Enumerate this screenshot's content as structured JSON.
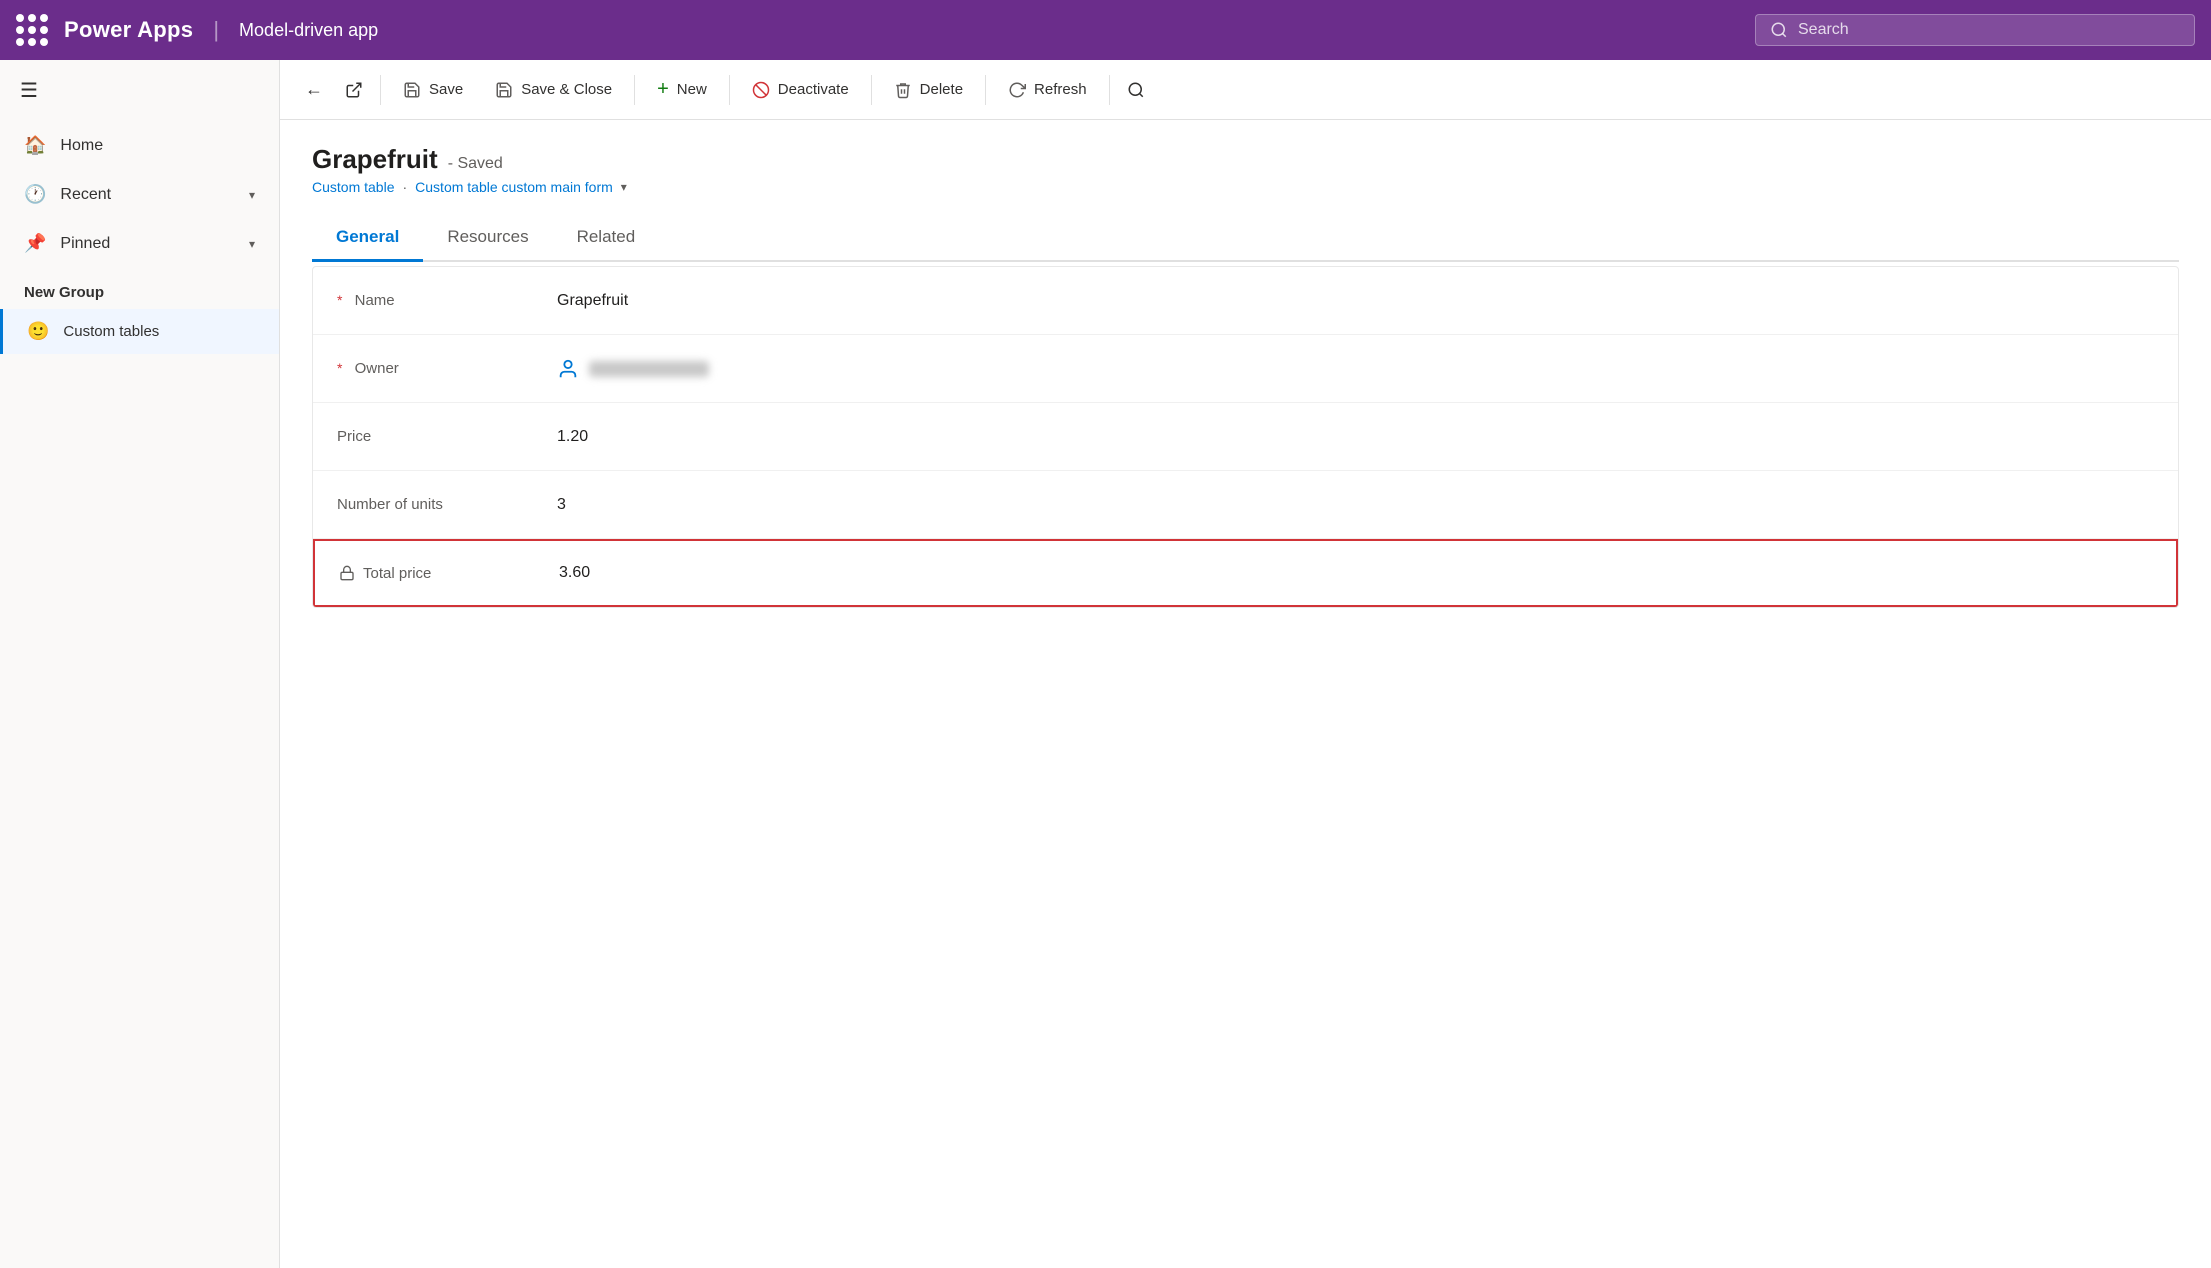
{
  "topbar": {
    "app_name": "Power Apps",
    "divider": "|",
    "model_app": "Model-driven app",
    "search_placeholder": "Search"
  },
  "sidebar": {
    "nav_items": [
      {
        "id": "home",
        "label": "Home",
        "icon": "🏠"
      },
      {
        "id": "recent",
        "label": "Recent",
        "icon": "🕐",
        "has_chevron": true
      },
      {
        "id": "pinned",
        "label": "Pinned",
        "icon": "📌",
        "has_chevron": true
      }
    ],
    "section_header": "New Group",
    "custom_item": {
      "label": "Custom tables",
      "emoji": "🙂"
    }
  },
  "toolbar": {
    "save_label": "Save",
    "save_close_label": "Save & Close",
    "new_label": "New",
    "deactivate_label": "Deactivate",
    "delete_label": "Delete",
    "refresh_label": "Refresh"
  },
  "page": {
    "title": "Grapefruit",
    "saved_badge": "- Saved",
    "breadcrumb_table": "Custom table",
    "breadcrumb_form": "Custom table custom main form",
    "tabs": [
      {
        "id": "general",
        "label": "General",
        "active": true
      },
      {
        "id": "resources",
        "label": "Resources",
        "active": false
      },
      {
        "id": "related",
        "label": "Related",
        "active": false
      }
    ],
    "form": {
      "fields": [
        {
          "id": "name",
          "label": "Name",
          "required": true,
          "value": "Grapefruit",
          "type": "text"
        },
        {
          "id": "owner",
          "label": "Owner",
          "required": true,
          "value": "",
          "type": "owner"
        },
        {
          "id": "price",
          "label": "Price",
          "required": false,
          "value": "1.20",
          "type": "text"
        },
        {
          "id": "units",
          "label": "Number of units",
          "required": false,
          "value": "3",
          "type": "text"
        },
        {
          "id": "total_price",
          "label": "Total price",
          "required": false,
          "value": "3.60",
          "type": "total",
          "highlighted": true
        }
      ]
    }
  }
}
